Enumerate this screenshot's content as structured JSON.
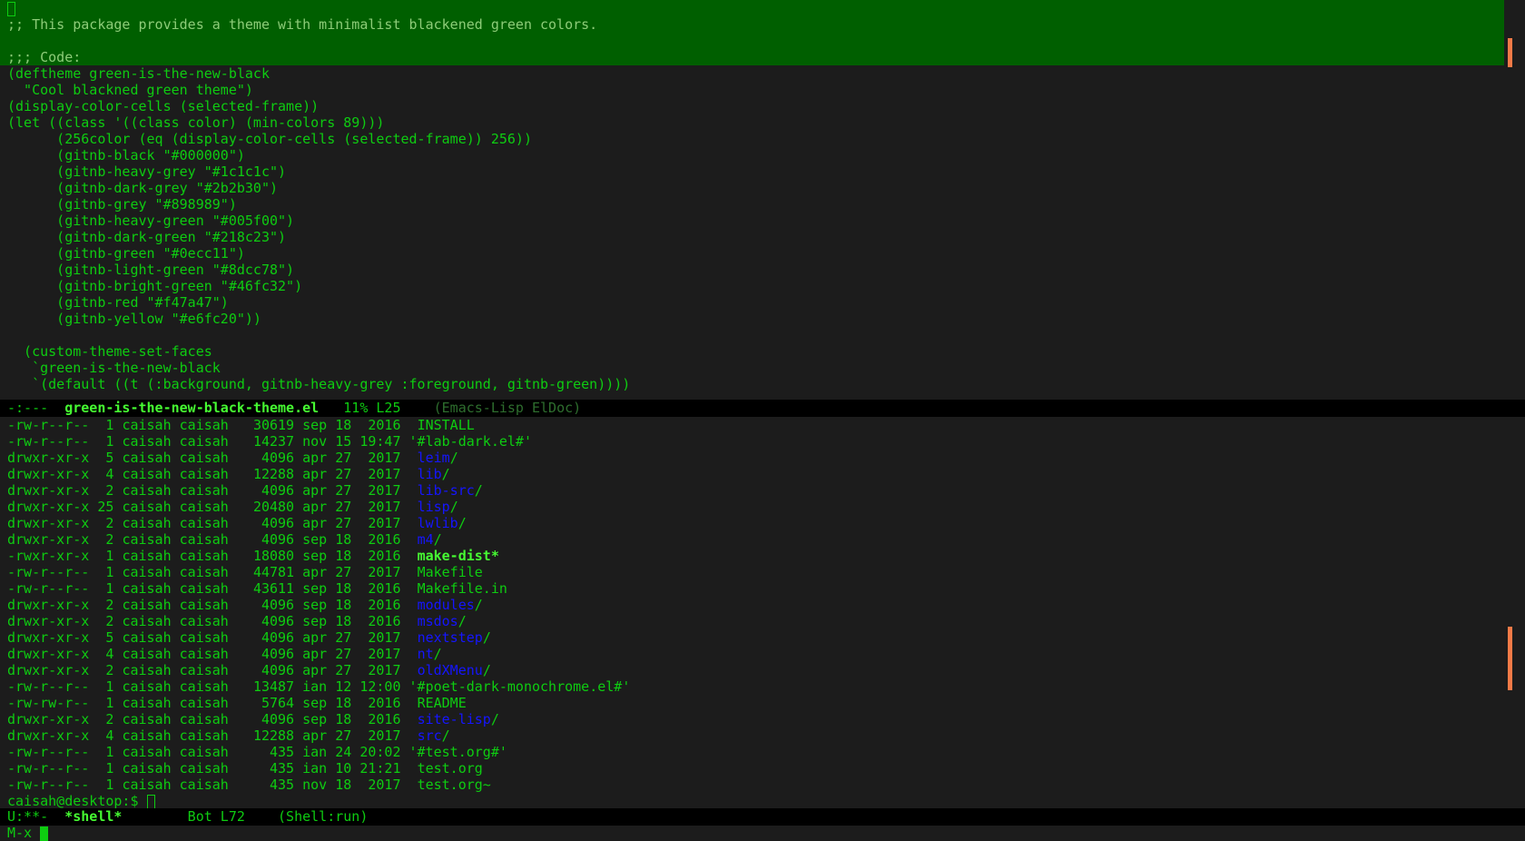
{
  "top_buffer": {
    "lines": [
      "",
      ";; This package provides a theme with minimalist blackened green colors.",
      "",
      ";;; Code:",
      "(deftheme green-is-the-new-black",
      "  \"Cool blackned green theme\")",
      "(display-color-cells (selected-frame))",
      "(let ((class '((class color) (min-colors 89)))",
      "      (256color (eq (display-color-cells (selected-frame)) 256))",
      "      (gitnb-black \"#000000\")",
      "      (gitnb-heavy-grey \"#1c1c1c\")",
      "      (gitnb-dark-grey \"#2b2b30\")",
      "      (gitnb-grey \"#898989\")",
      "      (gitnb-heavy-green \"#005f00\")",
      "      (gitnb-dark-green \"#218c23\")",
      "      (gitnb-green \"#0ecc11\")",
      "      (gitnb-light-green \"#8dcc78\")",
      "      (gitnb-bright-green \"#46fc32\")",
      "      (gitnb-red \"#f47a47\")",
      "      (gitnb-yellow \"#e6fc20\"))",
      "",
      "  (custom-theme-set-faces",
      "   `green-is-the-new-black",
      "   `(default ((t (:background, gitnb-heavy-grey :foreground, gitnb-green))))"
    ]
  },
  "modeline_top": {
    "status": "-:---  ",
    "buffer": "green-is-the-new-black-theme.el",
    "position": "   11% L25    ",
    "mode": "(Emacs-Lisp ElDoc)"
  },
  "listing": [
    {
      "perms": "-rw-r--r--",
      "links": " 1",
      "owner": "caisah",
      "group": "caisah",
      "size": "30619",
      "month": "sep",
      "day": "18",
      "time": " 2016",
      "name": "INSTALL",
      "type": "file"
    },
    {
      "perms": "-rw-r--r--",
      "links": " 1",
      "owner": "caisah",
      "group": "caisah",
      "size": "14237",
      "month": "nov",
      "day": "15",
      "time": "19:47",
      "name": "'#lab-dark.el#'",
      "type": "file"
    },
    {
      "perms": "drwxr-xr-x",
      "links": " 5",
      "owner": "caisah",
      "group": "caisah",
      "size": " 4096",
      "month": "apr",
      "day": "27",
      "time": " 2017",
      "name": "leim",
      "type": "dir"
    },
    {
      "perms": "drwxr-xr-x",
      "links": " 4",
      "owner": "caisah",
      "group": "caisah",
      "size": "12288",
      "month": "apr",
      "day": "27",
      "time": " 2017",
      "name": "lib",
      "type": "dir"
    },
    {
      "perms": "drwxr-xr-x",
      "links": " 2",
      "owner": "caisah",
      "group": "caisah",
      "size": " 4096",
      "month": "apr",
      "day": "27",
      "time": " 2017",
      "name": "lib-src",
      "type": "dir"
    },
    {
      "perms": "drwxr-xr-x",
      "links": "25",
      "owner": "caisah",
      "group": "caisah",
      "size": "20480",
      "month": "apr",
      "day": "27",
      "time": " 2017",
      "name": "lisp",
      "type": "dir"
    },
    {
      "perms": "drwxr-xr-x",
      "links": " 2",
      "owner": "caisah",
      "group": "caisah",
      "size": " 4096",
      "month": "apr",
      "day": "27",
      "time": " 2017",
      "name": "lwlib",
      "type": "dir"
    },
    {
      "perms": "drwxr-xr-x",
      "links": " 2",
      "owner": "caisah",
      "group": "caisah",
      "size": " 4096",
      "month": "sep",
      "day": "18",
      "time": " 2016",
      "name": "m4",
      "type": "dir"
    },
    {
      "perms": "-rwxr-xr-x",
      "links": " 1",
      "owner": "caisah",
      "group": "caisah",
      "size": "18080",
      "month": "sep",
      "day": "18",
      "time": " 2016",
      "name": "make-dist*",
      "type": "exe"
    },
    {
      "perms": "-rw-r--r--",
      "links": " 1",
      "owner": "caisah",
      "group": "caisah",
      "size": "44781",
      "month": "apr",
      "day": "27",
      "time": " 2017",
      "name": "Makefile",
      "type": "file"
    },
    {
      "perms": "-rw-r--r--",
      "links": " 1",
      "owner": "caisah",
      "group": "caisah",
      "size": "43611",
      "month": "sep",
      "day": "18",
      "time": " 2016",
      "name": "Makefile.in",
      "type": "file"
    },
    {
      "perms": "drwxr-xr-x",
      "links": " 2",
      "owner": "caisah",
      "group": "caisah",
      "size": " 4096",
      "month": "sep",
      "day": "18",
      "time": " 2016",
      "name": "modules",
      "type": "dir"
    },
    {
      "perms": "drwxr-xr-x",
      "links": " 2",
      "owner": "caisah",
      "group": "caisah",
      "size": " 4096",
      "month": "sep",
      "day": "18",
      "time": " 2016",
      "name": "msdos",
      "type": "dir"
    },
    {
      "perms": "drwxr-xr-x",
      "links": " 5",
      "owner": "caisah",
      "group": "caisah",
      "size": " 4096",
      "month": "apr",
      "day": "27",
      "time": " 2017",
      "name": "nextstep",
      "type": "dir"
    },
    {
      "perms": "drwxr-xr-x",
      "links": " 4",
      "owner": "caisah",
      "group": "caisah",
      "size": " 4096",
      "month": "apr",
      "day": "27",
      "time": " 2017",
      "name": "nt",
      "type": "dir"
    },
    {
      "perms": "drwxr-xr-x",
      "links": " 2",
      "owner": "caisah",
      "group": "caisah",
      "size": " 4096",
      "month": "apr",
      "day": "27",
      "time": " 2017",
      "name": "oldXMenu",
      "type": "dir"
    },
    {
      "perms": "-rw-r--r--",
      "links": " 1",
      "owner": "caisah",
      "group": "caisah",
      "size": "13487",
      "month": "ian",
      "day": "12",
      "time": "12:00",
      "name": "'#poet-dark-monochrome.el#'",
      "type": "file"
    },
    {
      "perms": "-rw-rw-r--",
      "links": " 1",
      "owner": "caisah",
      "group": "caisah",
      "size": " 5764",
      "month": "sep",
      "day": "18",
      "time": " 2016",
      "name": "README",
      "type": "file"
    },
    {
      "perms": "drwxr-xr-x",
      "links": " 2",
      "owner": "caisah",
      "group": "caisah",
      "size": " 4096",
      "month": "sep",
      "day": "18",
      "time": " 2016",
      "name": "site-lisp",
      "type": "dir"
    },
    {
      "perms": "drwxr-xr-x",
      "links": " 4",
      "owner": "caisah",
      "group": "caisah",
      "size": "12288",
      "month": "apr",
      "day": "27",
      "time": " 2017",
      "name": "src",
      "type": "dir"
    },
    {
      "perms": "-rw-r--r--",
      "links": " 1",
      "owner": "caisah",
      "group": "caisah",
      "size": "  435",
      "month": "ian",
      "day": "24",
      "time": "20:02",
      "name": "'#test.org#'",
      "type": "file"
    },
    {
      "perms": "-rw-r--r--",
      "links": " 1",
      "owner": "caisah",
      "group": "caisah",
      "size": "  435",
      "month": "ian",
      "day": "10",
      "time": "21:21",
      "name": "test.org",
      "type": "file"
    },
    {
      "perms": "-rw-r--r--",
      "links": " 1",
      "owner": "caisah",
      "group": "caisah",
      "size": "  435",
      "month": "nov",
      "day": "18",
      "time": " 2017",
      "name": "test.org~",
      "type": "file"
    }
  ],
  "prompt": "caisah@desktop:$ ",
  "modeline_bottom": {
    "status": "U:**-  ",
    "buffer": "*shell*",
    "position": "        Bot L72    ",
    "mode": "(Shell:run)"
  },
  "minibuffer": {
    "text": "M-x "
  },
  "colors": {
    "background": "#1c1c1c",
    "highlight": "#005f00",
    "foreground": "#0ecc11",
    "bright": "#46fc32",
    "string": "#8dcc78",
    "directory": "#1515ff",
    "scrollbar": "#f47a47"
  }
}
